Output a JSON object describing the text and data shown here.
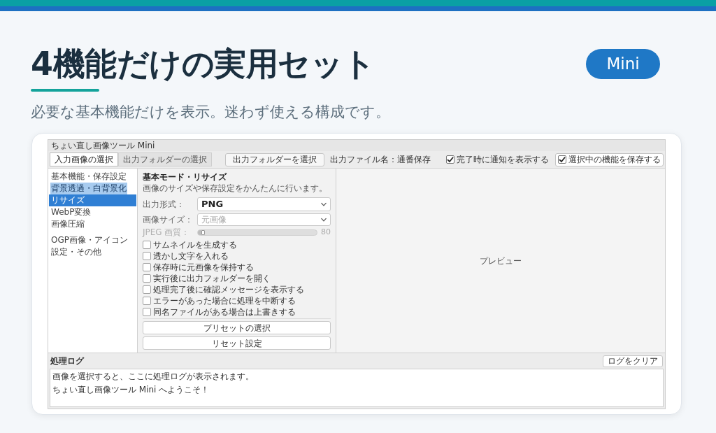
{
  "header": {
    "title": "4機能だけの実用セット",
    "subtitle": "必要な基本機能だけを表示。迷わず使える構成です。",
    "badge": "Mini"
  },
  "app_window": {
    "title": "ちょい直し画像ツール Mini",
    "tabs": [
      {
        "label": "入力画像の選択",
        "selected": true
      },
      {
        "label": "出力フォルダーの選択",
        "selected": false
      }
    ],
    "folder_button": "出力フォルダーを選択",
    "output_filename": "出力ファイル名：通番保存",
    "toolbar_checkboxes": [
      {
        "label": "完了時に通知を表示する",
        "checked": true,
        "focused": false
      },
      {
        "label": "選択中の機能を保存する",
        "checked": true,
        "focused": true
      }
    ],
    "sidebar": {
      "groups": [
        {
          "items": [
            {
              "label": "基本機能・保存設定",
              "selected": false,
              "highlighted": false
            },
            {
              "label": "背景透過・白背景化",
              "selected": false,
              "highlighted": true
            },
            {
              "label": "リサイズ",
              "selected": true,
              "highlighted": false
            },
            {
              "label": "WebP変換",
              "selected": false,
              "highlighted": false
            },
            {
              "label": "画像圧縮",
              "selected": false,
              "highlighted": false
            }
          ]
        },
        {
          "items": [
            {
              "label": "OGP画像・アイコン",
              "selected": false,
              "highlighted": false
            },
            {
              "label": "設定・その他",
              "selected": false,
              "highlighted": false
            }
          ]
        }
      ]
    },
    "settings_panel": {
      "title": "基本モード・リサイズ",
      "description": "画像のサイズや保存設定をかんたんに行います。",
      "fields": [
        {
          "kind": "select",
          "label": "出力形式：",
          "value": "PNG",
          "disabled": false
        },
        {
          "kind": "select",
          "label": "画像サイズ：",
          "placeholder": "元画像",
          "disabled": false
        },
        {
          "kind": "slider",
          "label": "JPEG 画質：",
          "level": 0.03,
          "reading": "80",
          "disabled": true
        }
      ],
      "options": [
        {
          "label": "サムネイルを生成する",
          "checked": false
        },
        {
          "label": "透かし文字を入れる",
          "checked": false
        },
        {
          "label": "保存時に元画像を保持する",
          "checked": false
        },
        {
          "label": "実行後に出力フォルダーを開く",
          "checked": false
        },
        {
          "label": "処理完了後に確認メッセージを表示する",
          "checked": false
        },
        {
          "label": "エラーがあった場合に処理を中断する",
          "checked": false
        },
        {
          "label": "同名ファイルがある場合は上書きする",
          "checked": false
        }
      ],
      "buttons": [
        "プリセットの選択",
        "リセット設定"
      ]
    },
    "preview": {
      "label": "プレビュー"
    },
    "log": {
      "title": "処理ログ",
      "clear_button": "ログをクリア",
      "lines": [
        "画像を選択すると、ここに処理ログが表示されます。",
        "ちょい直し画像ツール Mini へようこそ！"
      ]
    }
  }
}
